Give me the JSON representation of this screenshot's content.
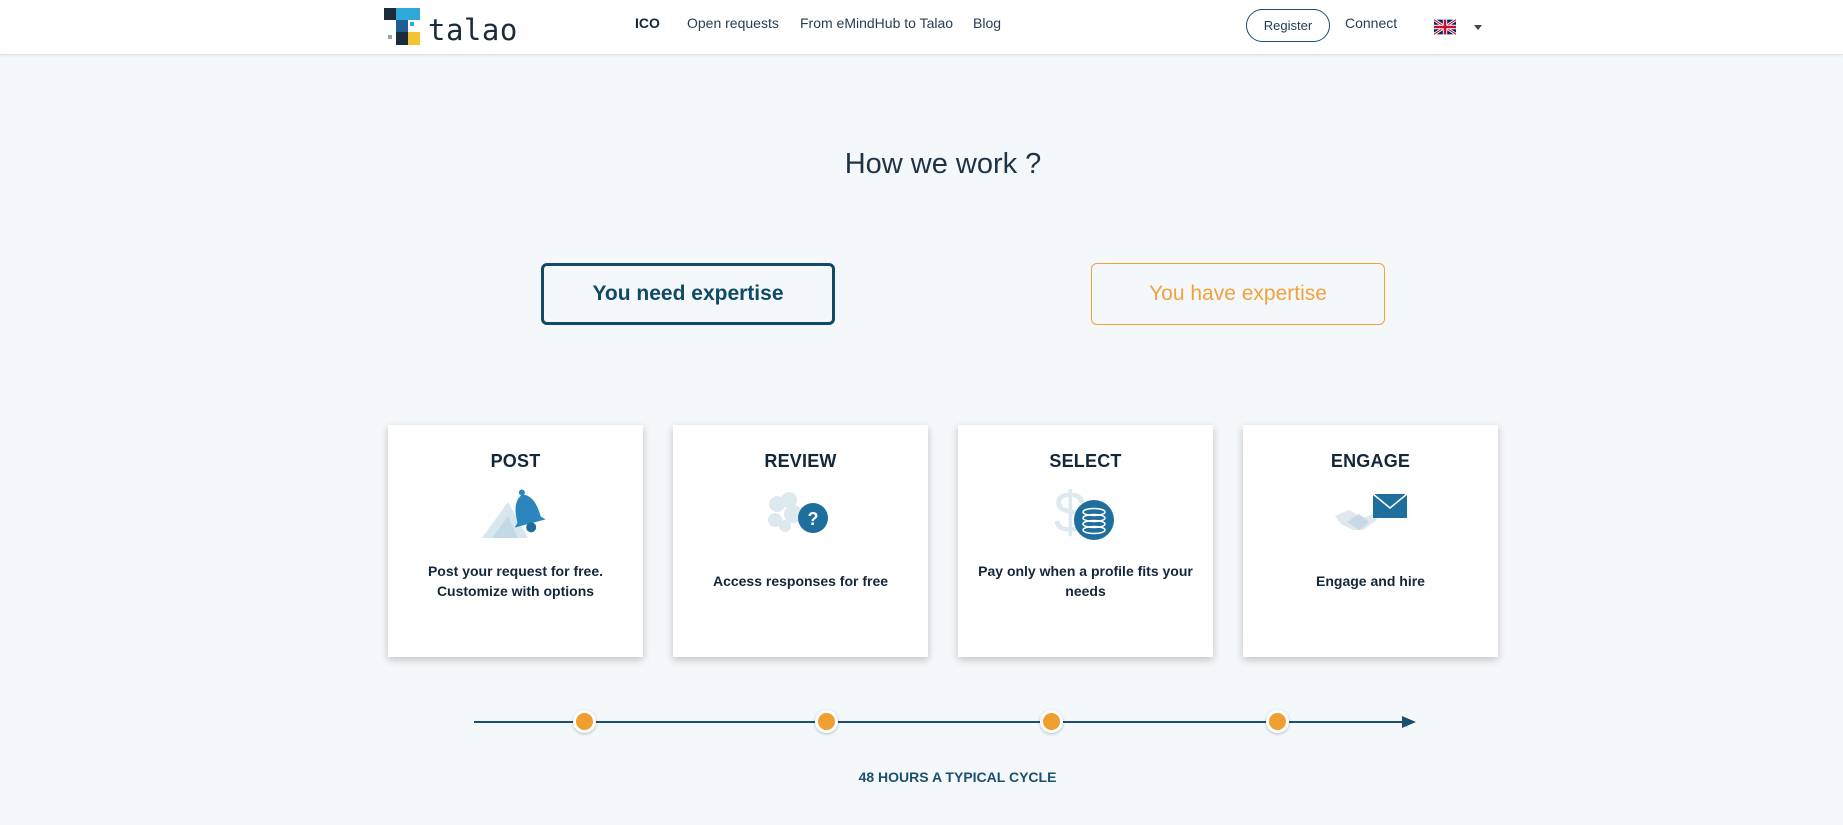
{
  "header": {
    "logo_text": "talao",
    "nav": [
      {
        "label": "ICO",
        "active": true
      },
      {
        "label": "Open requests",
        "active": false
      },
      {
        "label": "From eMindHub to Talao",
        "active": false
      },
      {
        "label": "Blog",
        "active": false
      }
    ],
    "register_label": "Register",
    "connect_label": "Connect",
    "language": {
      "selected": "English",
      "flag": "uk-flag"
    }
  },
  "main": {
    "title": "How we work ?",
    "toggle": {
      "need_label": "You need expertise",
      "have_label": "You have expertise",
      "selected": "You need expertise"
    },
    "steps": [
      {
        "title": "POST",
        "icon": "bell-icon",
        "description": [
          "Post your request for free.",
          "Customize with options"
        ]
      },
      {
        "title": "REVIEW",
        "icon": "question-icon",
        "description": [
          "Access responses for free"
        ]
      },
      {
        "title": "SELECT",
        "icon": "coins-icon",
        "description": [
          "Pay only when a profile fits your",
          "needs"
        ]
      },
      {
        "title": "ENGAGE",
        "icon": "handshake-mail-icon",
        "description": [
          "Engage and hire"
        ]
      }
    ],
    "timeline_label": "48 HOURS A TYPICAL CYCLE"
  },
  "colors": {
    "primary": "#0f4a66",
    "accent": "#ef9f30",
    "background": "#f5f8fb",
    "card": "#ffffff"
  }
}
